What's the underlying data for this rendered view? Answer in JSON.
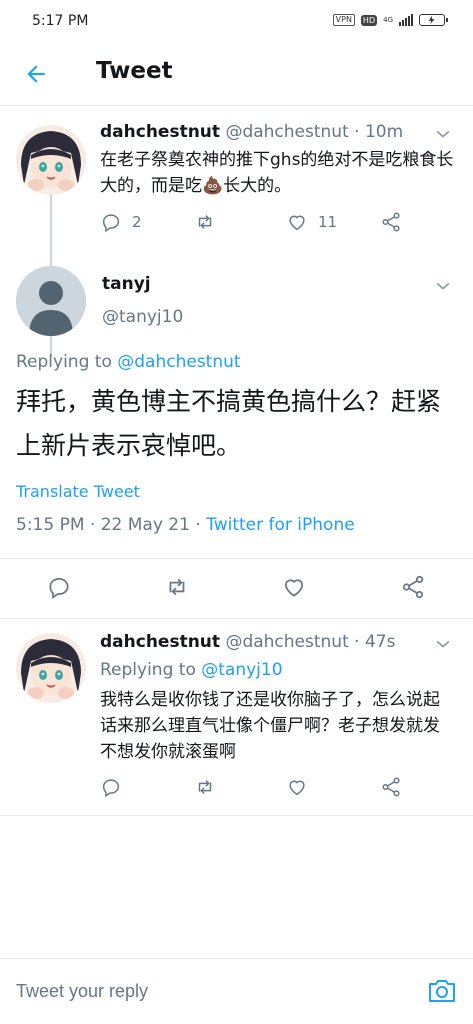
{
  "status_bar": {
    "time": "5:17 PM",
    "vpn": "VPN",
    "hd": "HD",
    "network": "4G"
  },
  "header": {
    "title": "Tweet",
    "back_icon": "arrow-left-icon"
  },
  "tweets": [
    {
      "name": "dahchestnut",
      "handle": "@dahchestnut",
      "time": "· 10m",
      "text_part1": "在老子祭奠农神的推下ghs的绝对不是吃粮食长大的，而是吃",
      "emoji": "💩",
      "text_part2": "长大的。",
      "replies": "2",
      "retweets": "",
      "likes": "11"
    },
    {
      "name": "tanyj",
      "handle": "@tanyj10",
      "replying_label": "Replying to",
      "replying_to": "@dahchestnut",
      "text": "拜托，黄色博主不搞黄色搞什么？赶紧上新片表示哀悼吧。",
      "translate": "Translate Tweet",
      "meta_time": "5:15 PM · 22 May 21 · ",
      "meta_source": "Twitter for iPhone"
    },
    {
      "name": "dahchestnut",
      "handle": "@dahchestnut",
      "time": "· 47s",
      "replying_label": "Replying to",
      "replying_to": "@tanyj10",
      "text": "我特么是收你钱了还是收你脑子了，怎么说起话来那么理直气壮像个僵尸啊？老子想发就发不想发你就滚蛋啊"
    }
  ],
  "compose": {
    "placeholder": "Tweet your reply"
  },
  "colors": {
    "accent": "#1da1f2",
    "secondary_text": "#657786",
    "divider": "#e6ecf0"
  }
}
